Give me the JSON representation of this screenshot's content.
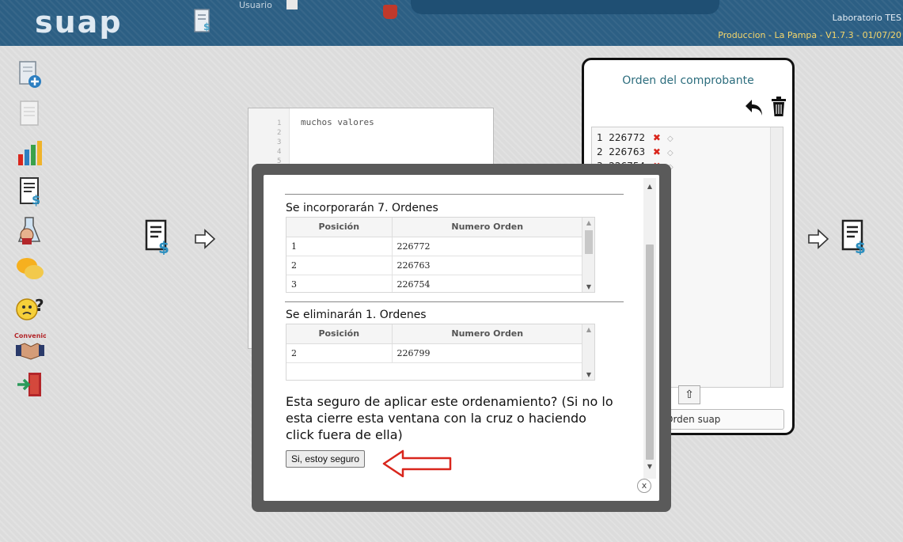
{
  "header": {
    "logo_text": "suap",
    "user_label": "Usuario",
    "lab_name": "Laboratorio TES",
    "env_info": "Produccion - La Pampa - V1.7.3 - 01/07/20"
  },
  "sidebar": {
    "items": [
      {
        "icon": "add-document-icon"
      },
      {
        "icon": "document-disabled-icon"
      },
      {
        "icon": "chart-icon"
      },
      {
        "icon": "invoice-icon"
      },
      {
        "icon": "lab-icon"
      },
      {
        "icon": "chat-icon"
      },
      {
        "icon": "help-icon"
      },
      {
        "icon": "convenio-icon",
        "label": "Convenio"
      },
      {
        "icon": "exit-icon"
      }
    ]
  },
  "editor": {
    "line_numbers": [
      "1",
      "2",
      "3",
      "4",
      "5"
    ],
    "text": "muchos valores"
  },
  "order_panel": {
    "title": "Orden del comprobante",
    "rows": [
      {
        "pos": "1",
        "order": "226772"
      },
      {
        "pos": "2",
        "order": "226763"
      },
      {
        "pos": "3",
        "order": "226754"
      }
    ],
    "up_button": "⇧",
    "suap_button": "Orden suap"
  },
  "dialog": {
    "incorporate_title": "Se incorporarán 7. Ordenes",
    "incorporate_table": {
      "headers": [
        "Posición",
        "Numero Orden"
      ],
      "rows": [
        [
          "1",
          "226772"
        ],
        [
          "2",
          "226763"
        ],
        [
          "3",
          "226754"
        ]
      ]
    },
    "delete_title": "Se eliminarán 1. Ordenes",
    "delete_table": {
      "headers": [
        "Posición",
        "Numero Orden"
      ],
      "rows": [
        [
          "2",
          "226799"
        ]
      ]
    },
    "confirm_text": "Esta seguro de aplicar este ordenamiento? (Si no lo esta cierre esta ventana con la cruz o haciendo click fuera de ella)",
    "confirm_button": "Si, estoy seguro",
    "close_label": "x"
  },
  "colors": {
    "header_bg": "#2c5f84",
    "env_text": "#f5d66b",
    "panel_title": "#2c6d7d",
    "delete_x": "#d9261c",
    "annotation_arrow": "#d9261c"
  }
}
